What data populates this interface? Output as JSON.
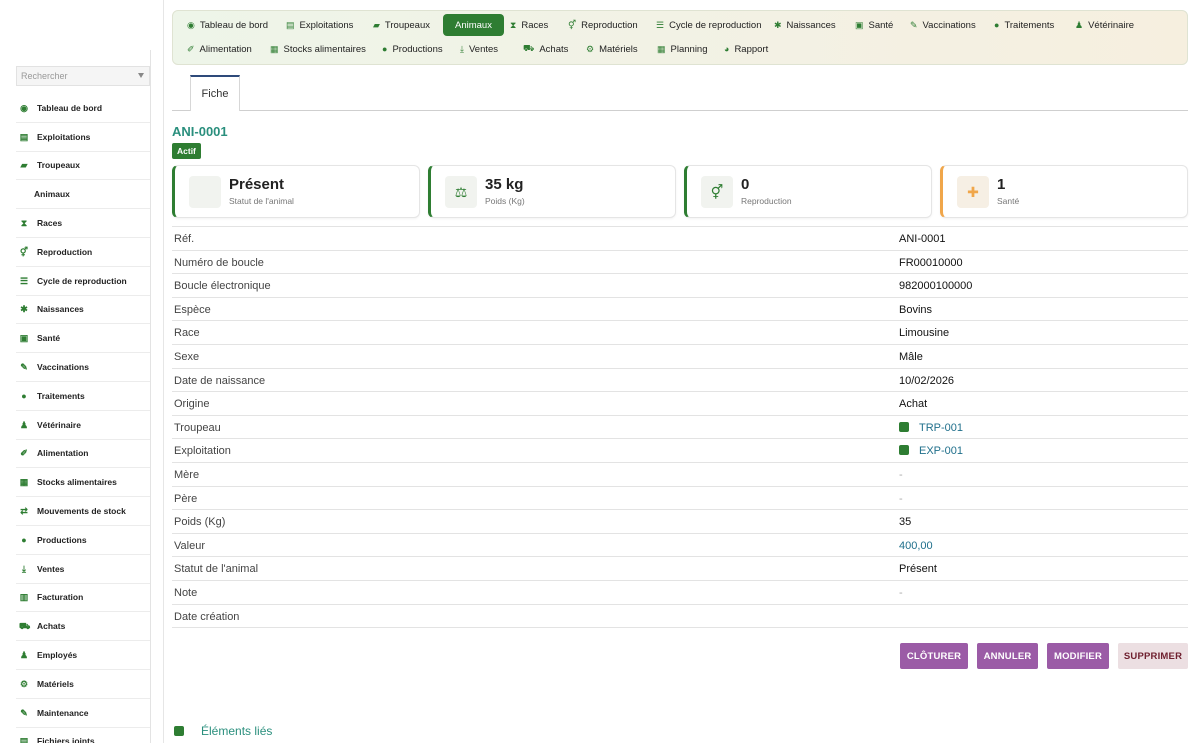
{
  "sidebar": {
    "search_placeholder": "Rechercher",
    "items": [
      {
        "label": "Tableau de bord",
        "icon": "dashboard-icon",
        "glyph": "◉"
      },
      {
        "label": "Exploitations",
        "icon": "farm-icon",
        "glyph": "▤"
      },
      {
        "label": "Troupeaux",
        "icon": "cow-icon",
        "glyph": "▰"
      },
      {
        "label": "Animaux",
        "icon": "",
        "glyph": ""
      },
      {
        "label": "Races",
        "icon": "dna-icon",
        "glyph": "⧗"
      },
      {
        "label": "Reproduction",
        "icon": "venus-mars-icon",
        "glyph": "⚥"
      },
      {
        "label": "Cycle de reproduction",
        "icon": "list-icon",
        "glyph": "☰"
      },
      {
        "label": "Naissances",
        "icon": "baby-icon",
        "glyph": "✱"
      },
      {
        "label": "Santé",
        "icon": "medkit-icon",
        "glyph": "▣"
      },
      {
        "label": "Vaccinations",
        "icon": "syringe-icon",
        "glyph": "✎"
      },
      {
        "label": "Traitements",
        "icon": "pills-icon",
        "glyph": "●"
      },
      {
        "label": "Vétérinaire",
        "icon": "doctor-icon",
        "glyph": "♟"
      },
      {
        "label": "Alimentation",
        "icon": "feed-icon",
        "glyph": "✐"
      },
      {
        "label": "Stocks alimentaires",
        "icon": "boxes-icon",
        "glyph": "▦"
      },
      {
        "label": "Mouvements de stock",
        "icon": "exchange-icon",
        "glyph": "⇄"
      },
      {
        "label": "Productions",
        "icon": "drop-icon",
        "glyph": "●"
      },
      {
        "label": "Ventes",
        "icon": "hand-icon",
        "glyph": "⤓"
      },
      {
        "label": "Facturation",
        "icon": "invoice-icon",
        "glyph": "▥"
      },
      {
        "label": "Achats",
        "icon": "cart-icon",
        "glyph": "⛟"
      },
      {
        "label": "Employés",
        "icon": "user-icon",
        "glyph": "♟"
      },
      {
        "label": "Matériels",
        "icon": "tractor-icon",
        "glyph": "⚙"
      },
      {
        "label": "Maintenance",
        "icon": "wrench-icon",
        "glyph": "✎"
      },
      {
        "label": "Fichiers joints",
        "icon": "file-icon",
        "glyph": "▤"
      }
    ]
  },
  "topnav": {
    "items": [
      {
        "label": "Tableau de bord",
        "icon": "dashboard-icon",
        "glyph": "◉"
      },
      {
        "label": "Exploitations",
        "icon": "farm-icon",
        "glyph": "▤"
      },
      {
        "label": "Troupeaux",
        "icon": "cow-icon",
        "glyph": "▰"
      },
      {
        "label": "Animaux",
        "icon": "",
        "glyph": ""
      },
      {
        "label": "Races",
        "icon": "dna-icon",
        "glyph": "⧗"
      },
      {
        "label": "Reproduction",
        "icon": "venus-mars-icon",
        "glyph": "⚥"
      },
      {
        "label": "Cycle de reproduction",
        "icon": "list-icon",
        "glyph": "☰"
      },
      {
        "label": "Naissances",
        "icon": "baby-icon",
        "glyph": "✱"
      },
      {
        "label": "Santé",
        "icon": "medkit-icon",
        "glyph": "▣"
      },
      {
        "label": "Vaccinations",
        "icon": "syringe-icon",
        "glyph": "✎"
      },
      {
        "label": "Traitements",
        "icon": "pills-icon",
        "glyph": "●"
      },
      {
        "label": "Vétérinaire",
        "icon": "doctor-icon",
        "glyph": "♟"
      },
      {
        "label": "Alimentation",
        "icon": "feed-icon",
        "glyph": "✐"
      },
      {
        "label": "Stocks alimentaires",
        "icon": "boxes-icon",
        "glyph": "▦"
      },
      {
        "label": "Productions",
        "icon": "drop-icon",
        "glyph": "●"
      },
      {
        "label": "Ventes",
        "icon": "hand-icon",
        "glyph": "⤓"
      },
      {
        "label": "Achats",
        "icon": "cart-icon",
        "glyph": "⛟"
      },
      {
        "label": "Matériels",
        "icon": "tractor-icon",
        "glyph": "⚙"
      },
      {
        "label": "Planning",
        "icon": "calendar-icon",
        "glyph": "▦"
      },
      {
        "label": "Rapport",
        "icon": "chart-icon",
        "glyph": "◕"
      }
    ]
  },
  "tabs": {
    "fiche": "Fiche"
  },
  "record": {
    "title": "ANI-0001",
    "status_badge": "Actif"
  },
  "cards": [
    {
      "value": "Présent",
      "label": "Statut de l'animal",
      "icon": "status-icon",
      "glyph": ""
    },
    {
      "value": "35 kg",
      "label": "Poids (Kg)",
      "icon": "weight-icon",
      "glyph": "⚖"
    },
    {
      "value": "0",
      "label": "Reproduction",
      "icon": "venus-mars-icon",
      "glyph": "⚥"
    },
    {
      "value": "1",
      "label": "Santé",
      "icon": "medkit-icon",
      "glyph": "✚"
    }
  ],
  "details": [
    {
      "key": "Réf.",
      "value": "ANI-0001"
    },
    {
      "key": "Numéro de boucle",
      "value": "FR00010000"
    },
    {
      "key": "Boucle électronique",
      "value": "982000100000"
    },
    {
      "key": "Espèce",
      "value": "Bovins"
    },
    {
      "key": "Race",
      "value": "Limousine"
    },
    {
      "key": "Sexe",
      "value": "Mâle"
    },
    {
      "key": "Date de naissance",
      "value": "10/02/2026"
    },
    {
      "key": "Origine",
      "value": "Achat"
    },
    {
      "key": "Troupeau",
      "value": "TRP-001"
    },
    {
      "key": "Exploitation",
      "value": "EXP-001"
    },
    {
      "key": "Mère",
      "value": "-"
    },
    {
      "key": "Père",
      "value": "-"
    },
    {
      "key": "Poids (Kg)",
      "value": "35"
    },
    {
      "key": "Valeur",
      "value": "400,00"
    },
    {
      "key": "Statut de l'animal",
      "value": "Présent"
    },
    {
      "key": "Note",
      "value": "-"
    },
    {
      "key": "Date création",
      "value": ""
    }
  ],
  "actions": {
    "cloturer": "CLÔTURER",
    "annuler": "ANNULER",
    "modifier": "MODIFIER",
    "supprimer": "SUPPRIMER"
  },
  "linked": {
    "title": "Éléments liés"
  }
}
